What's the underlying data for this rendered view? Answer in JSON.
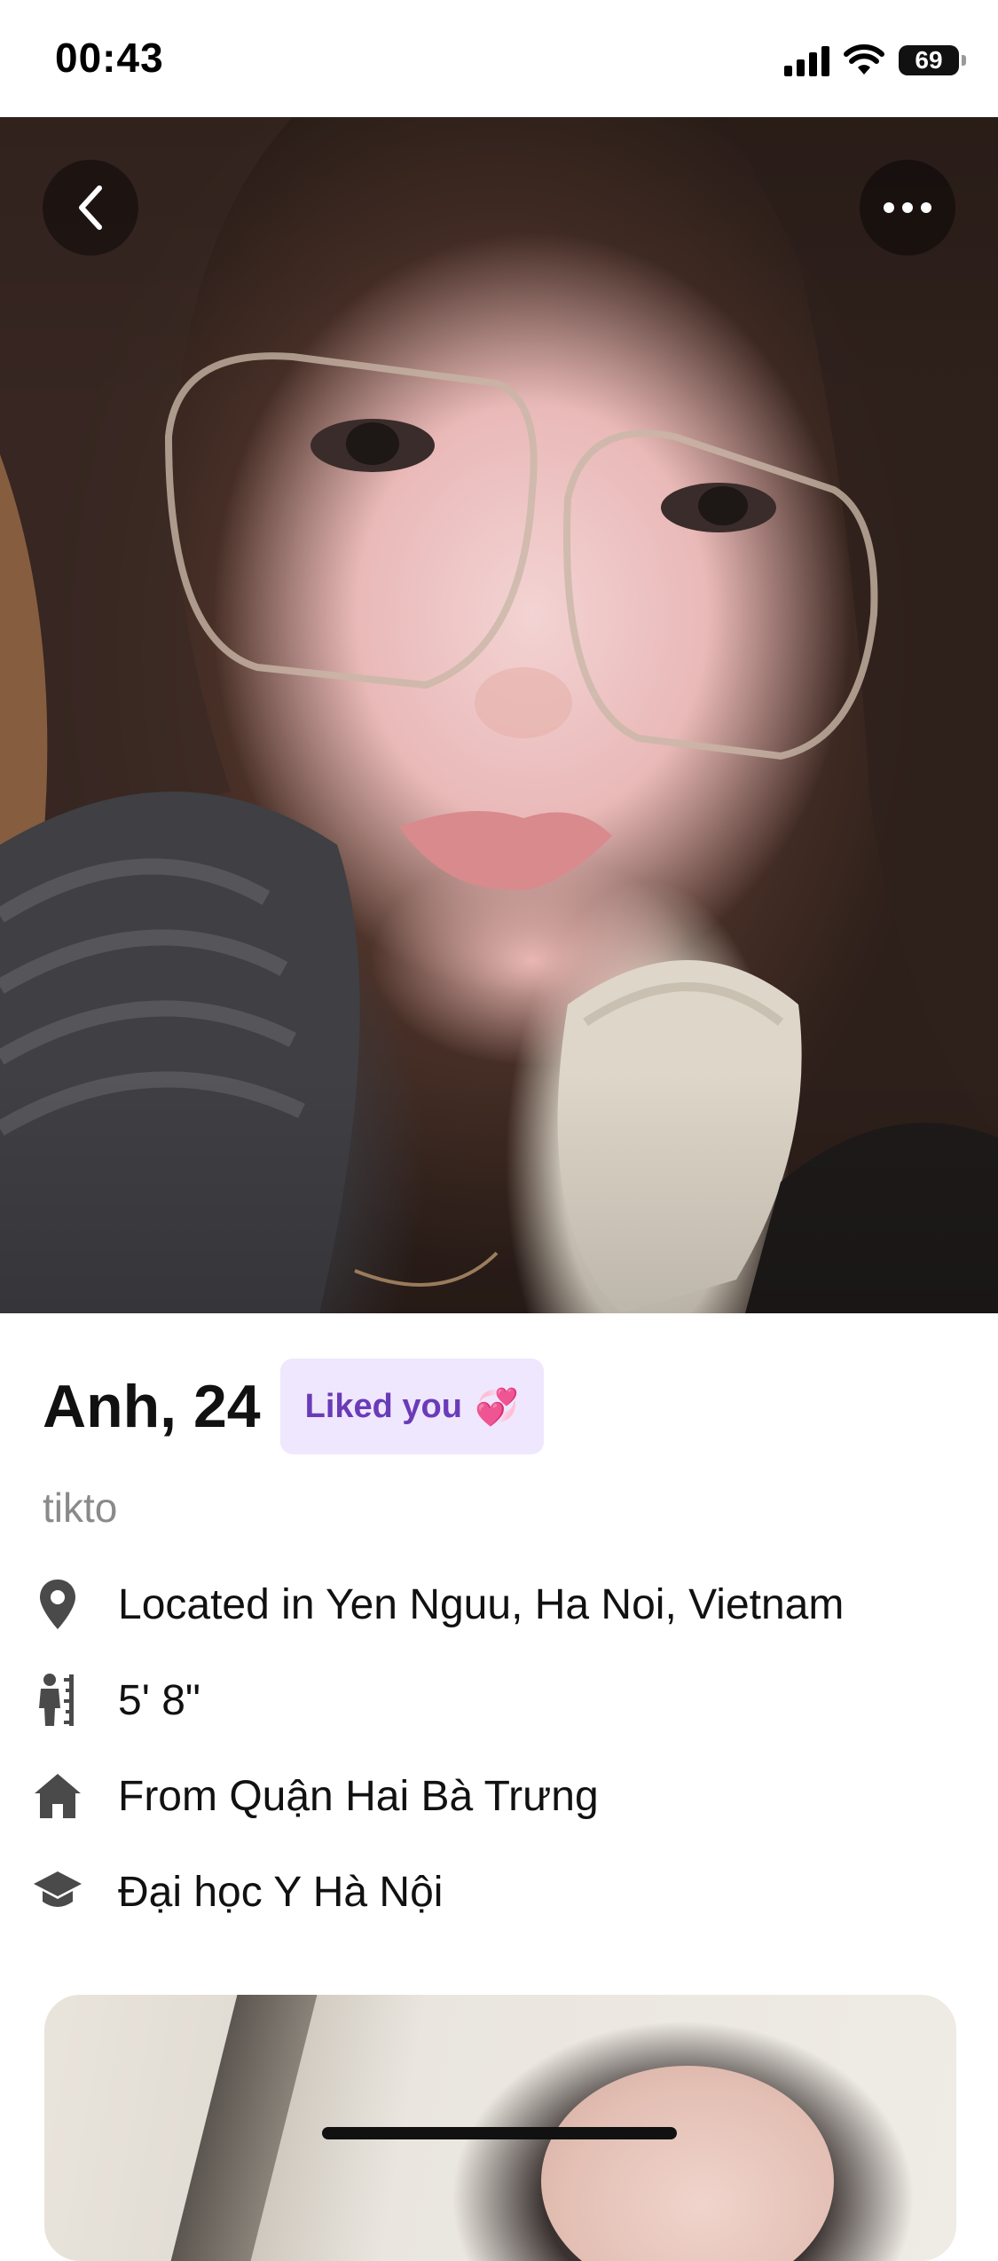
{
  "status_bar": {
    "time": "00:43",
    "battery": "69"
  },
  "hero": {
    "back_icon": "chevron-left-icon",
    "more_icon": "ellipsis-icon"
  },
  "profile": {
    "name_age": "Anh, 24",
    "liked_badge": "Liked you",
    "liked_emoji": "💞",
    "handle": "tikto",
    "details": [
      {
        "icon": "location-pin-icon",
        "text": "Located in Yen Nguu, Ha Noi, Vietnam"
      },
      {
        "icon": "height-icon",
        "text": "5' 8\""
      },
      {
        "icon": "home-icon",
        "text": "From Quận Hai Bà Trưng"
      },
      {
        "icon": "education-icon",
        "text": "Đại học Y Hà Nội"
      }
    ]
  },
  "colors": {
    "badge_bg": "#efe7fd",
    "badge_text": "#6a3bb8",
    "icon": "#4a4a4a"
  }
}
